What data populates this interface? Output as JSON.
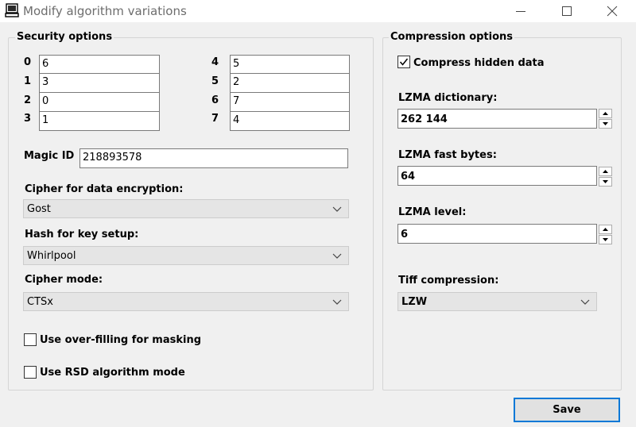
{
  "window": {
    "title": "Modify algorithm variations",
    "minimize_icon": "minimize-icon",
    "maximize_icon": "maximize-icon",
    "close_icon": "close-icon"
  },
  "security": {
    "legend": "Security options",
    "left_rows": [
      {
        "label": "0",
        "value": "6"
      },
      {
        "label": "1",
        "value": "3"
      },
      {
        "label": "2",
        "value": "0"
      },
      {
        "label": "3",
        "value": "1"
      }
    ],
    "right_rows": [
      {
        "label": "4",
        "value": "5"
      },
      {
        "label": "5",
        "value": "2"
      },
      {
        "label": "6",
        "value": "7"
      },
      {
        "label": "7",
        "value": "4"
      }
    ],
    "magic_id_label": "Magic ID",
    "magic_id_value": "218893578",
    "cipher_label": "Cipher for data encryption:",
    "cipher_value": "Gost",
    "hash_label": "Hash for key setup:",
    "hash_value": "Whirlpool",
    "mode_label": "Cipher mode:",
    "mode_value": "CTSx",
    "overfill_label": "Use over-filling for masking",
    "overfill_checked": false,
    "rsd_label": "Use RSD algorithm mode",
    "rsd_checked": false
  },
  "compression": {
    "legend": "Compression options",
    "compress_hidden_label": "Compress hidden data",
    "compress_hidden_checked": true,
    "dict_label": "LZMA dictionary:",
    "dict_value": "262 144",
    "fast_label": "LZMA fast bytes:",
    "fast_value": "64",
    "level_label": "LZMA level:",
    "level_value": "6",
    "tiff_label": "Tiff compression:",
    "tiff_value": "LZW"
  },
  "actions": {
    "save_label": "Save"
  },
  "colors": {
    "accent": "#0078d7",
    "window_bg": "#f0f0f0",
    "group_border": "#d5d5d5"
  }
}
